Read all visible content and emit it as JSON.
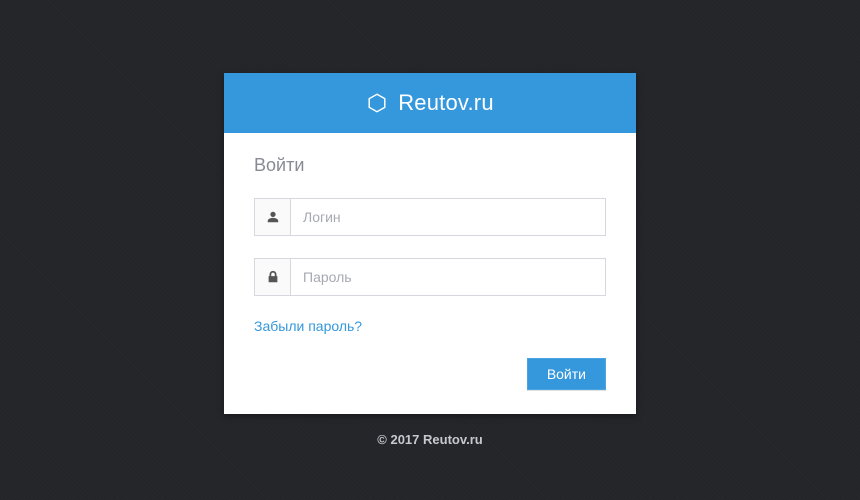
{
  "header": {
    "brand": "Reutov.ru"
  },
  "form": {
    "title": "Войти",
    "login": {
      "placeholder": "Логин",
      "value": ""
    },
    "password": {
      "placeholder": "Пароль",
      "value": ""
    },
    "forgot_label": "Забыли пароль?",
    "submit_label": "Войти"
  },
  "footer": {
    "text": "© 2017 Reutov.ru"
  },
  "colors": {
    "accent": "#3598dc",
    "page_bg": "#242529"
  }
}
